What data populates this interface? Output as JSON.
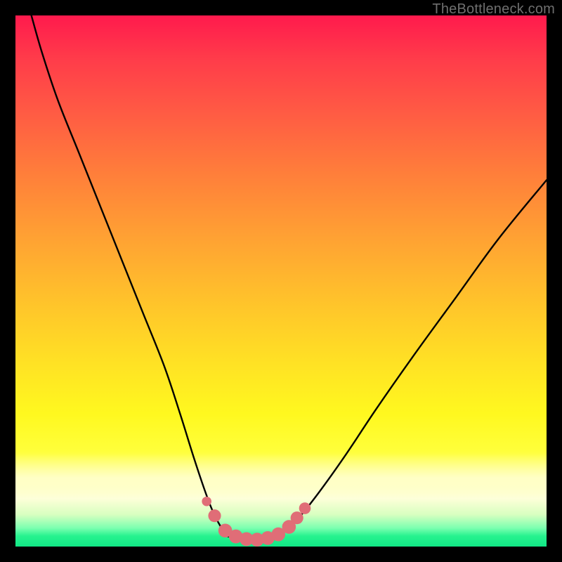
{
  "watermark": {
    "text": "TheBottleneck.com"
  },
  "colors": {
    "background": "#000000",
    "curve_stroke": "#000000",
    "marker_fill": "#e06d77",
    "gradient_top": "#ff1a4d",
    "gradient_bottom": "#11e685"
  },
  "chart_data": {
    "type": "line",
    "title": "",
    "xlabel": "",
    "ylabel": "",
    "xlim": [
      0,
      100
    ],
    "ylim": [
      0,
      100
    ],
    "grid": false,
    "legend": false,
    "note": "No numeric axis labels are rendered in the image; values are position estimates in percent of plot area (0,0 = bottom-left).",
    "series": [
      {
        "name": "left-branch",
        "x": [
          3,
          5,
          8,
          12,
          16,
          20,
          24,
          28,
          31,
          33.5,
          35.5,
          37,
          38.5,
          40
        ],
        "y": [
          100,
          93,
          84,
          74,
          64,
          54,
          44,
          34,
          25,
          17,
          11,
          7,
          4,
          2
        ]
      },
      {
        "name": "valley-floor",
        "x": [
          40,
          42,
          44,
          46,
          48,
          50
        ],
        "y": [
          2,
          1.3,
          1.1,
          1.1,
          1.4,
          2.2
        ]
      },
      {
        "name": "right-branch",
        "x": [
          50,
          53,
          57,
          62,
          68,
          75,
          83,
          91,
          100
        ],
        "y": [
          2.2,
          5,
          10,
          17,
          26,
          36,
          47,
          58,
          69
        ]
      }
    ],
    "markers": {
      "name": "valley-markers",
      "shape": "circle",
      "color": "#e06d77",
      "points": [
        {
          "x": 36.0,
          "y": 8.5,
          "r": 0.9
        },
        {
          "x": 37.5,
          "y": 5.8,
          "r": 1.2
        },
        {
          "x": 39.5,
          "y": 3.0,
          "r": 1.3
        },
        {
          "x": 41.5,
          "y": 1.9,
          "r": 1.3
        },
        {
          "x": 43.5,
          "y": 1.4,
          "r": 1.3
        },
        {
          "x": 45.5,
          "y": 1.3,
          "r": 1.3
        },
        {
          "x": 47.5,
          "y": 1.6,
          "r": 1.3
        },
        {
          "x": 49.5,
          "y": 2.3,
          "r": 1.3
        },
        {
          "x": 51.5,
          "y": 3.7,
          "r": 1.3
        },
        {
          "x": 53.0,
          "y": 5.4,
          "r": 1.2
        },
        {
          "x": 54.5,
          "y": 7.2,
          "r": 1.1
        }
      ]
    }
  }
}
